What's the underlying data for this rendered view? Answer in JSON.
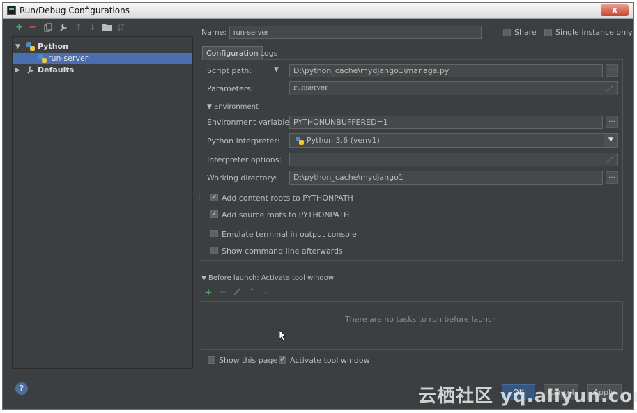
{
  "window": {
    "title": "Run/Debug Configurations",
    "close_label": "x"
  },
  "toolbar": {
    "icons": [
      "add-icon",
      "remove-icon",
      "copy-icon",
      "wrench-icon",
      "move-up-icon",
      "move-down-icon",
      "folder-icon",
      "sort-icon"
    ],
    "add_glyph": "+",
    "remove_glyph": "−",
    "up_glyph": "↑",
    "down_glyph": "↓"
  },
  "tree": {
    "python_label": "Python",
    "run_server_label": "run-server",
    "defaults_label": "Defaults"
  },
  "header": {
    "name_label": "Name:",
    "name_value": "run-server",
    "share_label": "Share",
    "single_instance_label": "Single instance only"
  },
  "tabs": [
    {
      "label": "Configuration"
    },
    {
      "label": "Logs"
    }
  ],
  "config": {
    "script_path_label": "Script path:",
    "script_path_value": "D:\\python_cache\\mydjango1\\manage.py",
    "parameters_label": "Parameters:",
    "parameters_value": "runserver",
    "environment_section": "Environment",
    "env_vars_label": "Environment variables:",
    "env_vars_value": "PYTHONUNBUFFERED=1",
    "interpreter_label": "Python interpreter:",
    "interpreter_value": "Python 3.6 (venv1)",
    "interp_options_label": "Interpreter options:",
    "interp_options_value": "",
    "working_dir_label": "Working directory:",
    "working_dir_value": "D:\\python_cache\\mydjango1",
    "add_content_roots_label": "Add content roots to PYTHONPATH",
    "add_source_roots_label": "Add source roots to PYTHONPATH",
    "emulate_terminal_label": "Emulate terminal in output console",
    "show_cmdline_label": "Show command line afterwards",
    "checked": {
      "content_roots": true,
      "source_roots": true,
      "emulate": false,
      "show_cmd": false
    }
  },
  "before_launch": {
    "title": "Before launch: Activate tool window",
    "empty_text": "There are no tasks to run before launch"
  },
  "footer": {
    "show_page_label": "Show this page",
    "activate_label": "Activate tool window",
    "help_glyph": "?",
    "ok_label": "OK",
    "cancel_label": "Cancel",
    "apply_label": "Apply"
  },
  "watermark": "云栖社区 yq.aliyun.com",
  "colors": {
    "bg": "#3c3f41",
    "selection": "#4b6eaf",
    "add_green": "#59a869",
    "remove_red": "#c75450"
  }
}
